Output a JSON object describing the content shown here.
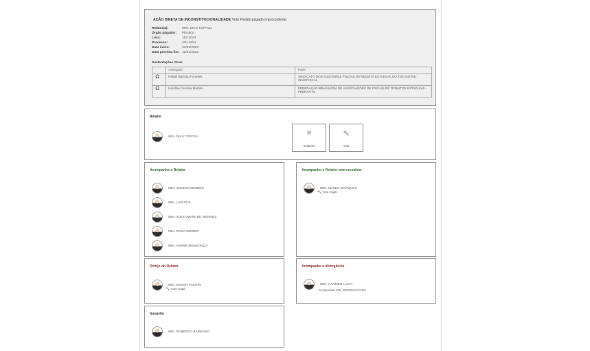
{
  "header": {
    "title_bold": "AÇÃO DIRETA DE INCONSTITUCIONALIDADE",
    "title_rest": "Voto Pedido julgado improcedente."
  },
  "details": [
    {
      "key": "Relator(a):",
      "value": "MIN. DIAS TOFFOLI"
    },
    {
      "key": "Órgão julgador:",
      "value": "Plenário"
    },
    {
      "key": "Lista:",
      "value": "157-2023"
    },
    {
      "key": "Processo:",
      "value": "ADI 4214"
    },
    {
      "key": "Data início:",
      "value": "31/03/2023"
    },
    {
      "key": "Data prevista fim:",
      "value": "12/04/2023"
    }
  ],
  "sustentacoes": {
    "title": "Sustentações Orais",
    "headers": {
      "advogado": "Advogado",
      "parte": "Parte"
    },
    "rows": [
      {
        "advogado": "Rafael Barroso Fonteles",
        "parte": "SINDICATO DOS AUDITORES FISCAIS DA RECEITA ESTADUAL DO TOCANTINS - SINDIFISCAL"
      },
      {
        "advogado": "Karoline Ferreira Martins",
        "parte": "FEDERAÇÃO BRASILEIRA DE ASSOCIAÇÕES DE FISCAIS DE TRIBUTOS ESTADUAIS - FEBRAFITE"
      }
    ]
  },
  "relator": {
    "title": "Relator",
    "name": "MIN. DIAS TOFFOLI",
    "buttons": [
      {
        "label": "Relatório",
        "icon": "document-icon"
      },
      {
        "label": "Voto",
        "icon": "gavel-icon"
      }
    ]
  },
  "acompanho_relator": {
    "title": "Acompanho o Relator",
    "members": [
      "MIN. GILMAR MENDES",
      "MIN. LUIZ FUX",
      "MIN. ALEXANDRE DE MORAES",
      "MIN. ROSA WEBER",
      "MIN. ANDRÉ MENDONÇA"
    ]
  },
  "acompanho_ressalvas": {
    "title": "Acompanho o Relator com ressalvas",
    "members": [
      {
        "name": "MIN. NUNES MARQUES",
        "note": "Voto Vogal"
      }
    ]
  },
  "divirjo": {
    "title": "Divirjo do Relator",
    "members": [
      {
        "name": "MIN. EDSON FACHIN",
        "note": "Voto Vogal"
      }
    ]
  },
  "divergencia": {
    "title": "Acompanho a divergência",
    "members": [
      {
        "name": "MIN. CARMEN LÚCIA",
        "note": "Acompanhar MIN. EDSON FACHIN"
      }
    ]
  },
  "suspeito": {
    "title": "Suspeito",
    "members": [
      "MIN. ROBERTO BARROSO"
    ]
  },
  "colors": {
    "green_title": "#2e6b2a",
    "red_title": "#8a2a2a",
    "border": "#8a8a8a",
    "panel_bg": "#efefef"
  }
}
